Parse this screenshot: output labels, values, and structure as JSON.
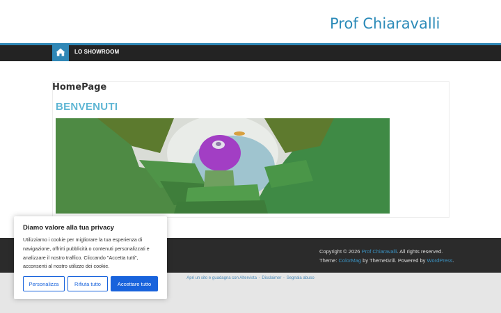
{
  "header": {
    "site_title": "Prof Chiaravalli"
  },
  "nav": {
    "home_icon": "home-icon",
    "items": [
      "LO SHOWROOM"
    ]
  },
  "main": {
    "heading": "HomePage",
    "welcome": "BENVENUTI",
    "hero_image": "illustration-hands-around-purple-figure"
  },
  "footer": {
    "copyright_prefix": "Copyright © 2026 ",
    "copyright_site": "Prof Chiaravalli",
    "copyright_suffix": ". All rights reserved.",
    "theme_prefix": "Theme: ",
    "theme_name": "ColorMag",
    "theme_middle": " by ThemeGrill. Powered by ",
    "powered_by": "WordPress",
    "theme_suffix": "."
  },
  "bottom_bar": {
    "link1": "Apri un sito e guadagna con Altervista",
    "sep1": " - ",
    "link2": "Disclaimer",
    "sep2": " - ",
    "link3": "Segnala abuso"
  },
  "cookie_banner": {
    "title": "Diamo valore alla tua privacy",
    "text": "Utilizziamo i cookie per migliorare la tua esperienza di navigazione, offrirti pubblicità o contenuti personalizzati e analizzare il nostro traffico. Cliccando \"Accetta tutti\", acconsenti al nostro utilizzo dei cookie.",
    "customize_label": "Personalizza",
    "reject_label": "Rifiuta tutto",
    "accept_label": "Accettare tutto"
  },
  "colors": {
    "accent": "#2f87b6",
    "title": "#2b8ab8",
    "welcome": "#5fb6d4",
    "cookie_button": "#1863dc",
    "nav_bg": "#232323",
    "footer_bg": "#2b2b2b"
  }
}
